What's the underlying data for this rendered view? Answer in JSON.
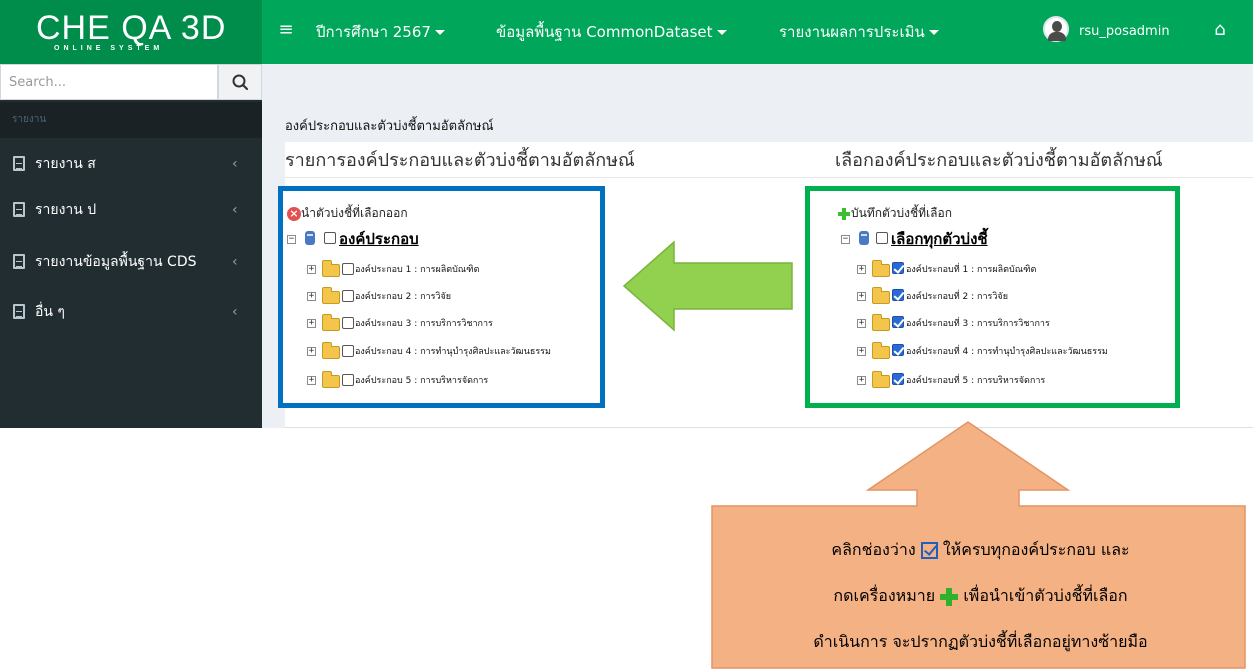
{
  "brand": {
    "logo_text": "CHE QA 3D",
    "logo_sub": "ONLINE SYSTEM"
  },
  "navbar": {
    "menu_icon": "hamburger-icon",
    "year_label": "ปีการศึกษา 2567",
    "dataset_label": "ข้อมูลพื้นฐาน CommonDataset",
    "report_label": "รายงานผลการประเมิน",
    "user_name": "rsu_posadmin",
    "home_icon": "home-icon"
  },
  "sidebar": {
    "search_placeholder": "Search...",
    "header": "รายงาน",
    "items": [
      {
        "label": "รายงาน ส",
        "chevron": "‹"
      },
      {
        "label": "รายงาน ป",
        "chevron": "‹"
      },
      {
        "label": "รายงานข้อมูลพื้นฐาน CDS",
        "chevron": "‹"
      },
      {
        "label": "อื่น ๆ",
        "chevron": "‹"
      }
    ]
  },
  "content": {
    "page_title": "องค์ประกอบและตัวบ่งชี้ตามอัตลักษณ์",
    "left_title": "รายการองค์ประกอบและตัวบ่งชี้ตามอัตลักษณ์",
    "right_title": "เลือกองค์ประกอบและตัวบ่งชี้ตามอัตลักษณ์",
    "left_panel": {
      "action_label": "นำตัวบ่งชี้ที่เลือกออก",
      "root_label": "องค์ประกอบ",
      "items": [
        "องค์ประกอบ 1 : การผลิตบัณฑิต",
        "องค์ประกอบ 2 : การวิจัย",
        "องค์ประกอบ 3 : การบริการวิชาการ",
        "องค์ประกอบ 4 : การทำนุบำรุงศิลปะและวัฒนธรรม",
        "องค์ประกอบ 5 : การบริหารจัดการ"
      ]
    },
    "right_panel": {
      "action_label": "บันทึกตัวบ่งชี้ที่เลือก",
      "root_label": "เลือกทุกตัวบ่งชี้",
      "items": [
        "องค์ประกอบที่ 1 : การผลิตบัณฑิต",
        "องค์ประกอบที่ 2 : การวิจัย",
        "องค์ประกอบที่ 3 : การบริการวิชาการ",
        "องค์ประกอบที่ 4 : การทำนุบำรุงศิลปะและวัฒนธรรม",
        "องค์ประกอบที่ 5 : การบริหารจัดการ"
      ]
    }
  },
  "callout": {
    "line1_a": "คลิกช่องว่าง",
    "line1_b": "ให้ครบทุกองค์ประกอบ และ",
    "line2_a": "กดเครื่องหมาย",
    "line2_b": "เพื่อนำเข้าตัวบ่งชี้ที่เลือก",
    "line3": "ดำเนินการ จะปรากฏตัวบ่งชี้ที่เลือกอยู่ทางซ้ายมือ"
  },
  "colors": {
    "navbar": "#00a65a",
    "brand_bg": "#008d4c",
    "sidebar": "#222d32",
    "left_box_border": "#0070c0",
    "right_box_border": "#00b050",
    "arrow_green": "#92d050",
    "callout_fill": "#f4b183"
  }
}
